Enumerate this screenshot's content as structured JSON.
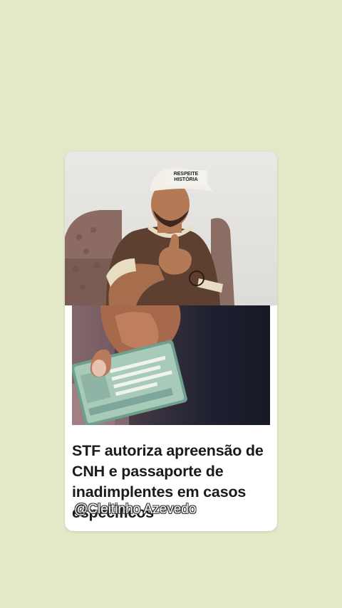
{
  "post": {
    "headline": "STF autoriza apreensão de CNH e passaporte de inadimplentes em casos específicos",
    "cap_text_line1": "RESPEITE",
    "cap_text_line2": "HISTÓRIA"
  },
  "overlay": {
    "watermark": "@Cleitinho Azevedo"
  },
  "colors": {
    "background": "#e3e8c9",
    "card": "#ffffff",
    "headline": "#1a1a1a"
  },
  "icons": [
    "person-video-still",
    "driver-license-photo"
  ]
}
